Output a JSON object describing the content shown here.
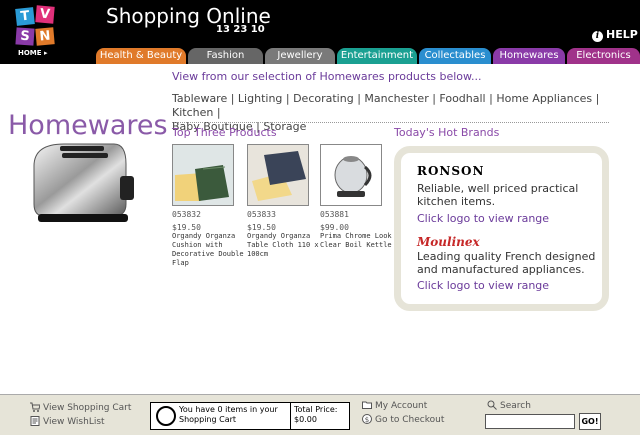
{
  "header": {
    "logo_letters": [
      "T",
      "V",
      "S",
      "N"
    ],
    "logo_sub": "HOME",
    "title": "Shopping Online",
    "phone": "13 23 10",
    "help_label": "HELP"
  },
  "tabs": [
    {
      "label": "Health & Beauty",
      "color": "#e07a2a"
    },
    {
      "label": "Fashion",
      "color": "#666666"
    },
    {
      "label": "Jewellery",
      "color": "#7a7a7a"
    },
    {
      "label": "Entertainment",
      "color": "#1aa092"
    },
    {
      "label": "Collectables",
      "color": "#2a8ecf"
    },
    {
      "label": "Homewares",
      "color": "#8a3aa8"
    },
    {
      "label": "Electronics",
      "color": "#a0328a"
    }
  ],
  "main": {
    "intro": "View from our selection of Homewares products below...",
    "categories_line1": "Tableware | Lighting | Decorating | Manchester | Foodhall | Home Appliances | Kitchen |",
    "categories_line2": "Baby Boutique | Storage",
    "page_heading": "Homewares",
    "top_three_heading": "Top Three Products",
    "hot_brands_heading": "Today's Hot Brands"
  },
  "products": [
    {
      "code": "053832",
      "price": "$19.50",
      "name": "Organdy Organza Cushion with Decorative Double Flap"
    },
    {
      "code": "053833",
      "price": "$19.50",
      "name": "Organdy Organza Table Cloth 110 x 100cm"
    },
    {
      "code": "053881",
      "price": "$99.00",
      "name": "Prima Chrome Look Clear Boil Kettle"
    }
  ],
  "brands": [
    {
      "logo_text": "RONSON",
      "description": "Reliable, well priced practical kitchen items.",
      "link": "Click logo to view range"
    },
    {
      "logo_text": "Moulinex",
      "description": "Leading quality French designed and manufactured appliances.",
      "link": "Click logo to view range"
    }
  ],
  "footer": {
    "view_cart": "View Shopping Cart",
    "view_wishlist": "View WishList",
    "cart_message": "You have 0 items in your Shopping Cart",
    "total_label": "Total Price:",
    "total_value": "$0.00",
    "my_account": "My Account",
    "checkout": "Go to Checkout",
    "search_label": "Search",
    "search_value": "",
    "go_label": "GO!"
  }
}
